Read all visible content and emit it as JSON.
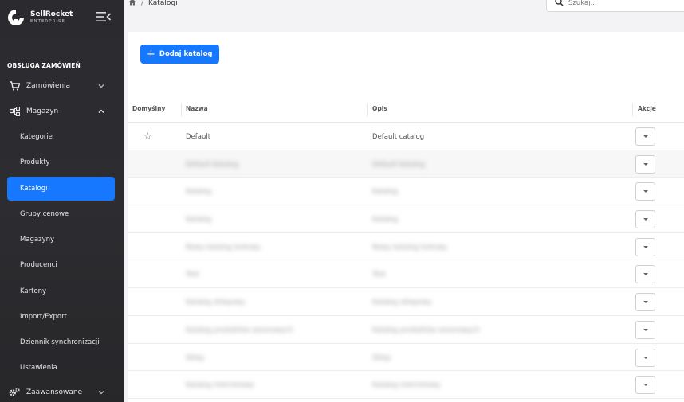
{
  "brand": {
    "name": "SellRocket",
    "subtitle": "ENTERPRISE"
  },
  "sidebar": {
    "section_title": "OBSŁUGA ZAMÓWIEŃ",
    "items": [
      {
        "label": "Zamówienia",
        "icon": "cart-icon",
        "expanded": false
      },
      {
        "label": "Magazyn",
        "icon": "network-icon",
        "expanded": true
      }
    ],
    "sub_items": [
      {
        "label": "Kategorie"
      },
      {
        "label": "Produkty"
      },
      {
        "label": "Katalogi",
        "active": true
      },
      {
        "label": "Grupy cenowe"
      },
      {
        "label": "Magazyny"
      },
      {
        "label": "Producenci"
      },
      {
        "label": "Kartony"
      },
      {
        "label": "Import/Export"
      },
      {
        "label": "Dziennik synchronizacji"
      },
      {
        "label": "Ustawienia"
      }
    ],
    "bottom_item": {
      "label": "Zaawansowane",
      "icon": "gears-icon"
    }
  },
  "breadcrumb": {
    "current": "Katalogi"
  },
  "search": {
    "placeholder": "Szukaj..."
  },
  "toolbar": {
    "add_label": "Dodaj katalog"
  },
  "table": {
    "headers": {
      "default": "Domyślny",
      "name": "Nazwa",
      "description": "Opis",
      "actions": "Akcje"
    },
    "rows": [
      {
        "name": "Default",
        "description": "Default catalog",
        "blurred": false
      },
      {
        "name": "Default Katalog",
        "description": "Default Katalog",
        "blurred": true
      },
      {
        "name": "Katalog",
        "description": "Katalog",
        "blurred": true
      },
      {
        "name": "Katalog",
        "description": "Katalog",
        "blurred": true
      },
      {
        "name": "Nowy katalog testowy",
        "description": "Nowy katalog testowy",
        "blurred": true
      },
      {
        "name": "Test",
        "description": "Test",
        "blurred": true
      },
      {
        "name": "Katalog sklepowy",
        "description": "Katalog sklepowy",
        "blurred": true
      },
      {
        "name": "Katalog produktów sezonowych",
        "description": "Katalog produktów sezonowych",
        "blurred": true
      },
      {
        "name": "Sklep",
        "description": "Sklep",
        "blurred": true
      },
      {
        "name": "Katalog internetowy",
        "description": "Katalog internetowy",
        "blurred": true
      }
    ]
  },
  "colors": {
    "accent": "#1677ff",
    "sidebar_bg": "#2b2b2f"
  }
}
